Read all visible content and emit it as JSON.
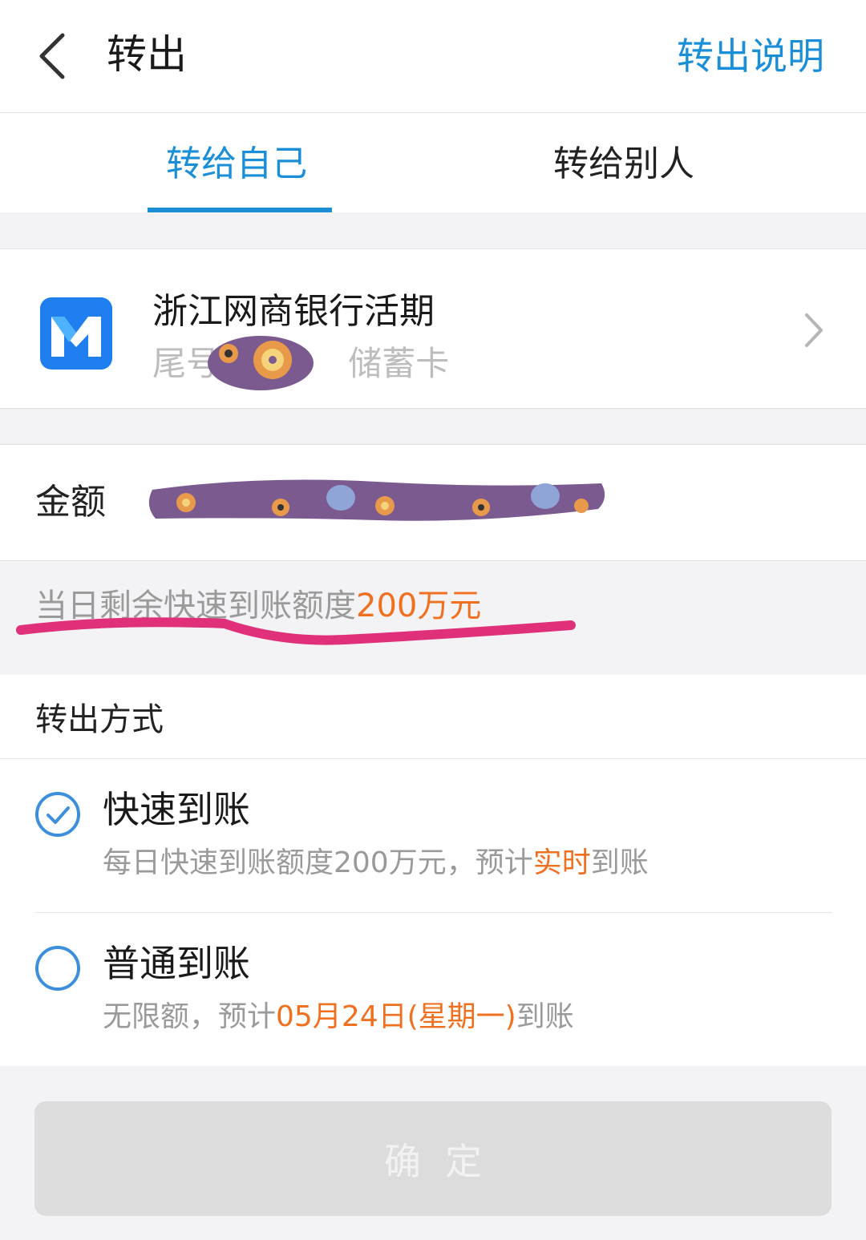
{
  "header": {
    "back_icon": "chevron-left-icon",
    "title": "转出",
    "help_link": "转出说明"
  },
  "tabs": [
    {
      "label": "转给自己",
      "active": true
    },
    {
      "label": "转给别人",
      "active": false
    }
  ],
  "account": {
    "bank_name": "浙江网商银行活期",
    "tail_prefix": "尾号",
    "card_type": "储蓄卡",
    "logo_icon": "mybank-logo-icon",
    "chevron": "chevron-right-icon"
  },
  "amount": {
    "label": "金额"
  },
  "quota": {
    "text": "当日剩余快速到账额度",
    "amount": "200万元"
  },
  "transfer_methods": {
    "title": "转出方式",
    "options": [
      {
        "title": "快速到账",
        "selected": true,
        "desc_prefix": "每日快速到账额度200万元，预计",
        "desc_highlight": "实时",
        "desc_suffix": "到账"
      },
      {
        "title": "普通到账",
        "selected": false,
        "desc_prefix": "无限额，预计",
        "desc_highlight": "05月24日(星期一)",
        "desc_suffix": "到账"
      }
    ]
  },
  "confirm_button": {
    "label": "确定",
    "enabled": false
  },
  "colors": {
    "accent_blue": "#1a8fd8",
    "highlight_orange": "#f07020",
    "annotation_pink": "#e0307a"
  }
}
